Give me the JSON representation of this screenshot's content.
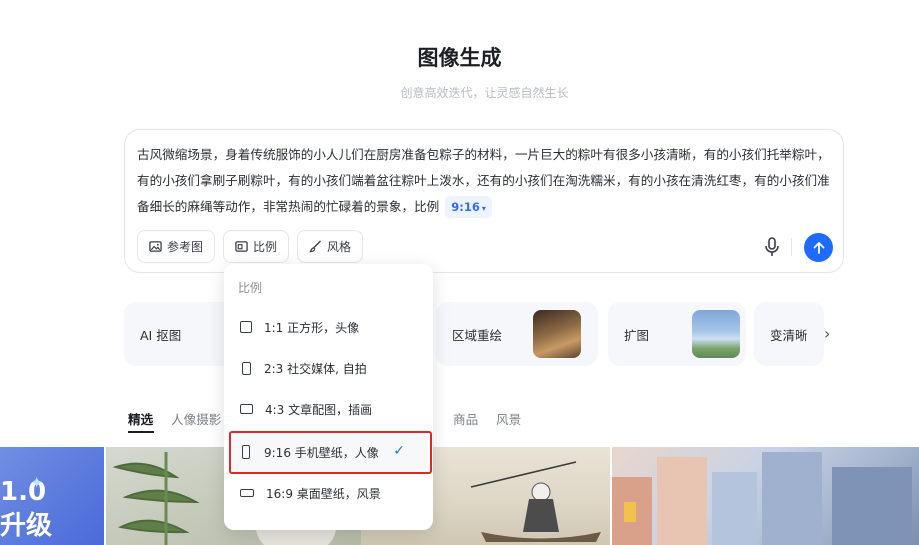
{
  "header": {
    "title": "图像生成",
    "subtitle": "创意高效迭代，让灵感自然生长"
  },
  "prompt": {
    "text": "古风微缩场景，身着传统服饰的小人儿们在厨房准备包粽子的材料，一片巨大的粽叶有很多小孩清晰，有的小孩们托举粽叶，有的小孩们拿刷子刷粽叶，有的小孩们端着盆往粽叶上泼水，还有的小孩们在淘洗糯米，有的小孩在清洗红枣，有的小孩们准备细长的麻绳等动作，非常热闹的忙碌着的景象，比例",
    "ratio_chip": "9:16"
  },
  "toolbar": {
    "reference_label": "参考图",
    "ratio_label": "比例",
    "style_label": "风格"
  },
  "features": [
    {
      "label": "AI 抠图"
    },
    {
      "label": "区域重绘"
    },
    {
      "label": "扩图"
    },
    {
      "label": "变清晰"
    }
  ],
  "categories": [
    "精选",
    "人像摄影",
    "",
    "商品",
    "风景"
  ],
  "gallery": {
    "banner_line1": "1.0",
    "banner_line2": "升级"
  },
  "ratio_menu": {
    "header": "比例",
    "options": [
      {
        "label": "1:1 正方形，头像",
        "selected": false
      },
      {
        "label": "2:3 社交媒体, 自拍",
        "selected": false
      },
      {
        "label": "4:3 文章配图，插画",
        "selected": false
      },
      {
        "label": "9:16 手机壁纸，人像",
        "selected": true
      },
      {
        "label": "16:9 桌面壁纸，风景",
        "selected": false
      }
    ]
  },
  "colors": {
    "accent": "#1f6bff",
    "highlight_border": "#e02727"
  }
}
